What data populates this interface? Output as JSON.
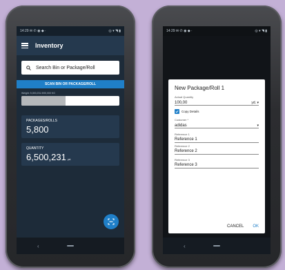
{
  "left_screen": {
    "status": {
      "time": "14:29",
      "indicators": "✉ ✆ ◉ ◆ ·",
      "right_icons": "◎ ▾ ◥ ▮"
    },
    "appbar": {
      "title": "Inventory"
    },
    "search": {
      "placeholder": "Search Bin or Package/Roll"
    },
    "scan_button": "SCAN BIN OR PACKAGE/ROLL",
    "weight": {
      "label": "Weight: 5,000,231.9/00,000 KG",
      "fill_percent": 45
    },
    "packages_card": {
      "label": "PACKAGES/ROLLS",
      "value": "5,800"
    },
    "quantity_card": {
      "label": "QUANTITY",
      "value": "6,500,231",
      "unit": "yd."
    },
    "fab_icon": "scan-icon",
    "nav": {
      "back": "‹"
    }
  },
  "right_screen": {
    "status": {
      "time": "14:29",
      "indicators": "✉ ✆ ◉ ◆ ·",
      "right_icons": "◎ ▾ ◥ ▮"
    },
    "dialog": {
      "title": "New Package/Roll 1",
      "quantity_label": "Actual Quantity",
      "quantity_value": "100,00",
      "quantity_unit": "yd. ▾",
      "copy_details_label": "Copy Details",
      "customer_label": "Customer *",
      "customer_value": "adidas",
      "ref1_label": "Reference 1",
      "ref1_value": "Reference 1",
      "ref2_label": "Reference 2",
      "ref2_value": "Reference 2",
      "ref3_label": "Reference 3",
      "ref3_value": "Reference 3",
      "cancel_label": "CANCEL",
      "ok_label": "OK"
    },
    "nav": {
      "back": "‹"
    }
  },
  "colors": {
    "accent": "#1f7fc8",
    "appbar": "#25394e",
    "screen_bg": "#1d2b39",
    "backdrop": "#c3b0d6"
  }
}
